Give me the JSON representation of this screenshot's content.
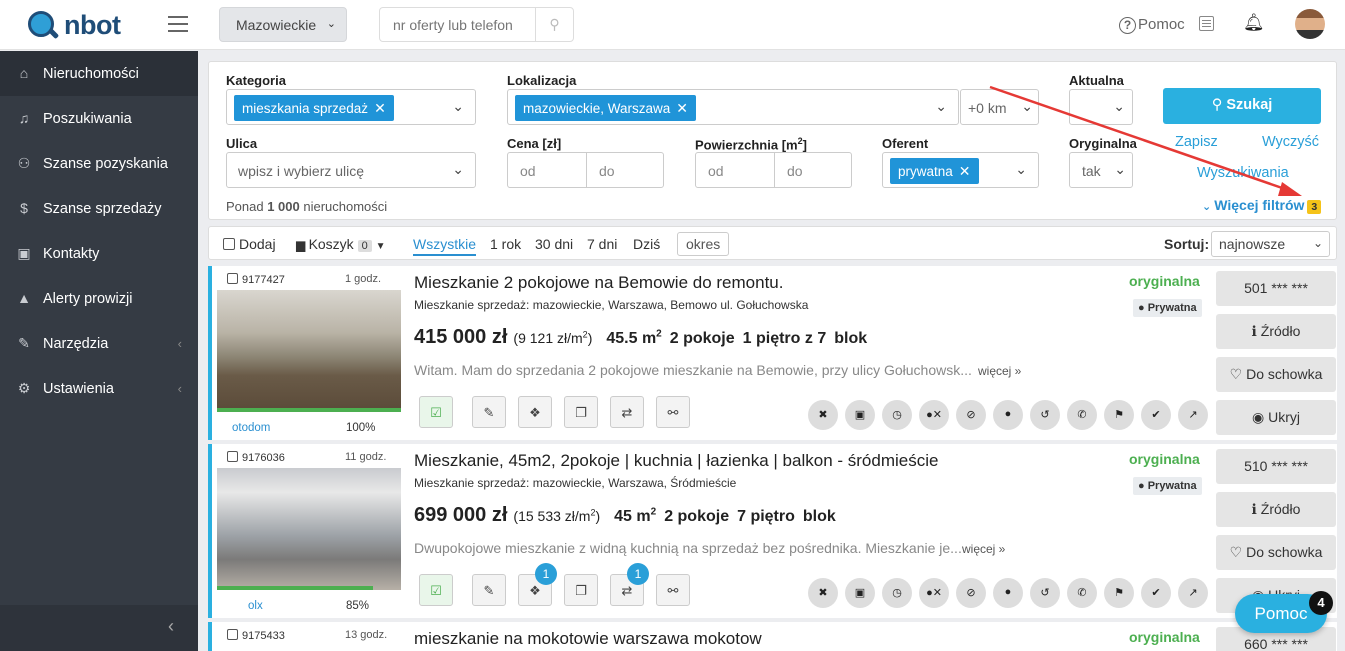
{
  "header": {
    "logo_text": "nbot",
    "region": "Mazowieckie",
    "search_placeholder": "nr oferty lub telefon",
    "help_label": "Pomoc"
  },
  "sidebar": {
    "items": [
      {
        "label": "Nieruchomości",
        "icon": "home-icon"
      },
      {
        "label": "Poszukiwania",
        "icon": "bell-icon"
      },
      {
        "label": "Szanse pozyskania",
        "icon": "handshake-icon"
      },
      {
        "label": "Szanse sprzedaży",
        "icon": "dollar-icon"
      },
      {
        "label": "Kontakty",
        "icon": "contact-icon"
      },
      {
        "label": "Alerty prowizji",
        "icon": "warning-icon"
      },
      {
        "label": "Narzędzia",
        "icon": "wrench-icon"
      },
      {
        "label": "Ustawienia",
        "icon": "gear-icon"
      }
    ]
  },
  "filters": {
    "kategoria_label": "Kategoria",
    "kategoria_tag": "mieszkania sprzedaż",
    "lokalizacja_label": "Lokalizacja",
    "lokalizacja_tag": "mazowieckie, Warszawa",
    "distance": "+0 km",
    "aktualna_label": "Aktualna",
    "szukaj_label": "Szukaj",
    "ulica_label": "Ulica",
    "ulica_placeholder": "wpisz i wybierz ulicę",
    "cena_label": "Cena [zł]",
    "powierzchnia_label": "Powierzchnia [m",
    "powierzchnia_sup": "2",
    "powierzchnia_end": "]",
    "od": "od",
    "do": "do",
    "oferent_label": "Oferent",
    "oferent_tag": "prywatna",
    "oryginalna_label": "Oryginalna",
    "oryginalna_value": "tak",
    "zapisz": "Zapisz",
    "wyczysc": "Wyczyść",
    "wyszukiwania": "Wyszukiwania",
    "ponad_prefix": "Ponad ",
    "ponad_count": "1 000",
    "ponad_suffix": " nieruchomości",
    "wiecej_label": "Więcej filtrów",
    "wiecej_badge": "3"
  },
  "toolbar": {
    "dodaj": "Dodaj",
    "koszyk": "Koszyk",
    "koszyk_count": "0",
    "tabs": [
      "Wszystkie",
      "1 rok",
      "30 dni",
      "7 dni",
      "Dziś"
    ],
    "okres": "okres",
    "sort_label": "Sortuj:",
    "sort_value": "najnowsze"
  },
  "listings": [
    {
      "id": "9177427",
      "time": "1 godz.",
      "source": "otodom",
      "pct": "100%",
      "pct_value": 100,
      "title": "Mieszkanie 2 pokojowe na Bemowie do remontu.",
      "subtitle": "Mieszkanie sprzedaż: mazowieckie, Warszawa, Bemowo ul. Gołuchowska",
      "price": "415 000 zł",
      "ppm": "(9 121 zł/m",
      "area": "45.5 m",
      "rooms": "2 pokoje",
      "floor": "1 piętro z 7",
      "type": "blok",
      "desc": "Witam. Mam do sprzedania 2 pokojowe mieszkanie na Bemowie, przy ulicy Gołuchowsk...",
      "more": "więcej »",
      "orig": "oryginalna",
      "priv": "Prywatna",
      "phone": "501 *** ***",
      "zrodlo": "Źródło",
      "schowek": "Do schowka",
      "ukryj": "Ukryj",
      "badge_a": "",
      "badge_b": ""
    },
    {
      "id": "9176036",
      "time": "11 godz.",
      "source": "olx",
      "pct": "85%",
      "pct_value": 85,
      "title": "Mieszkanie, 45m2, 2pokoje | kuchnia | łazienka | balkon - śródmieście ...",
      "subtitle": "Mieszkanie sprzedaż: mazowieckie, Warszawa, Śródmieście",
      "price": "699 000 zł",
      "ppm": "(15 533 zł/m",
      "area": "45 m",
      "rooms": "2 pokoje",
      "floor": "7 piętro",
      "type": "blok",
      "desc": "Dwupokojowe mieszkanie z widną kuchnią na sprzedaż bez pośrednika. Mieszkanie je...",
      "more": "więcej »",
      "orig": "oryginalna",
      "priv": "Prywatna",
      "phone": "510 *** ***",
      "zrodlo": "Źródło",
      "schowek": "Do schowka",
      "ukryj": "Ukryj",
      "badge_a": "1",
      "badge_b": "1"
    },
    {
      "id": "9175433",
      "time": "13 godz.",
      "title": "mieszkanie na mokotowie warszawa mokotow",
      "orig": "oryginalna",
      "phone": "660 *** ***"
    }
  ],
  "chat": {
    "label": "Pomoc",
    "badge": "4"
  },
  "colors": {
    "accent": "#2ab0e0",
    "sidebar": "#353b44",
    "green": "#4caf50",
    "annotation": "#e53935"
  }
}
